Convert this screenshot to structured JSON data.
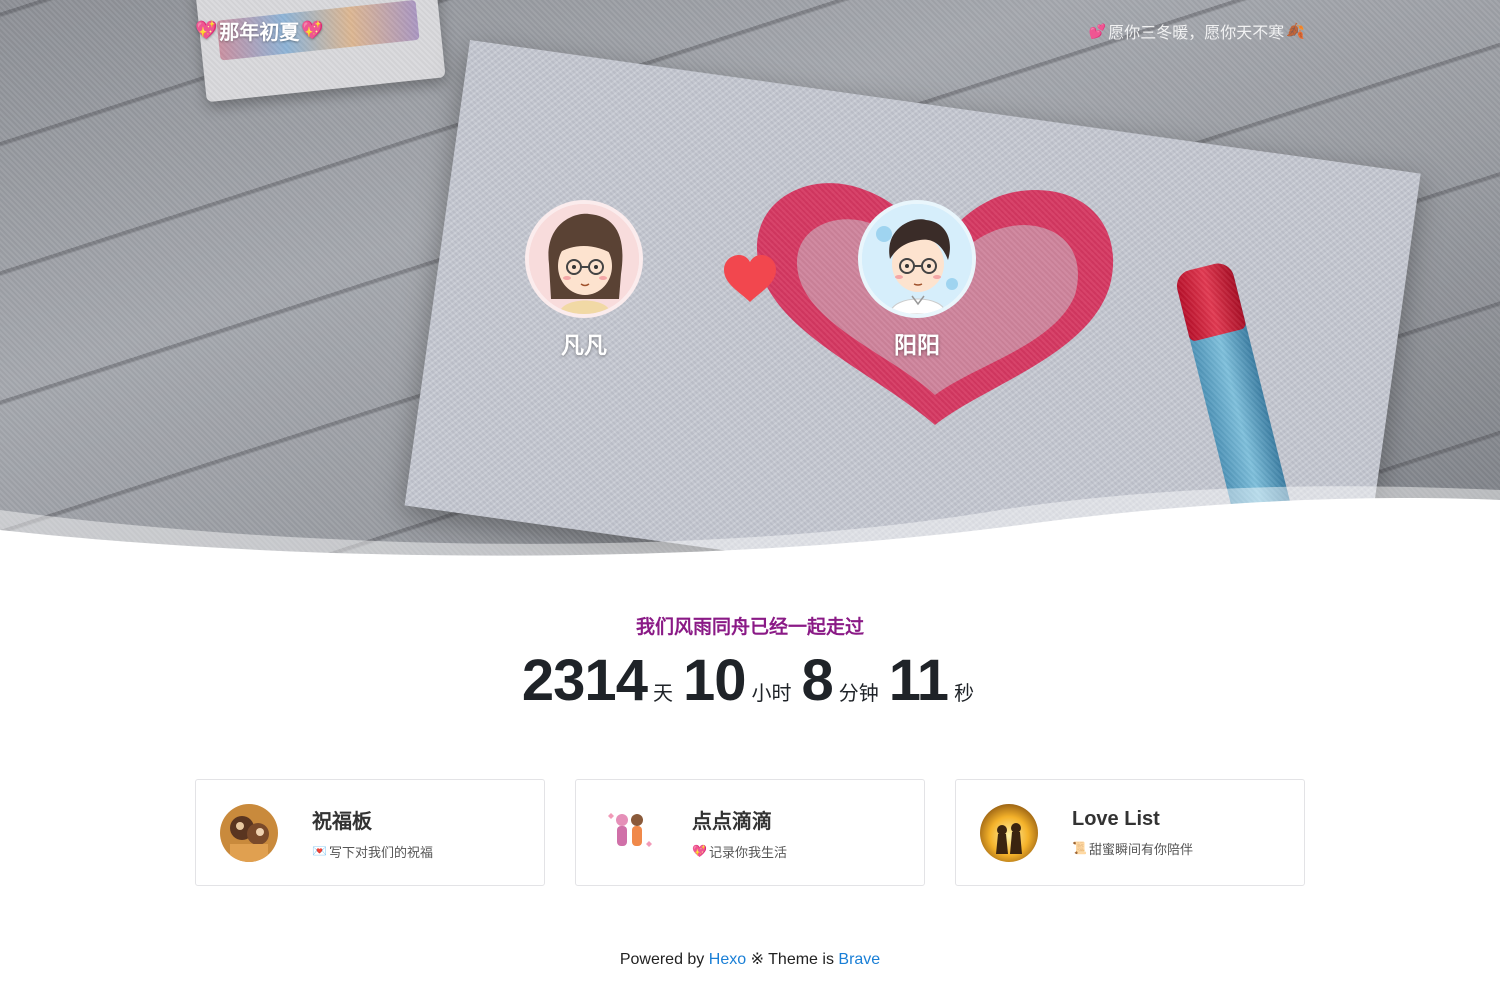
{
  "header": {
    "site_title": "那年初夏",
    "slogan": "愿你三冬暖，愿你天不寒"
  },
  "couple": {
    "left_name": "凡凡",
    "right_name": "阳阳"
  },
  "counter": {
    "title": "我们风雨同舟已经一起走过",
    "days": "2314",
    "days_unit": "天",
    "hours": "10",
    "hours_unit": "小时",
    "minutes": "8",
    "minutes_unit": "分钟",
    "seconds": "11",
    "seconds_unit": "秒"
  },
  "cards": [
    {
      "title": "祝福板",
      "subtitle": "写下对我们的祝福",
      "icon": "envelope-icon"
    },
    {
      "title": "点点滴滴",
      "subtitle": "记录你我生活",
      "icon": "sparkling-heart-icon"
    },
    {
      "title": "Love List",
      "subtitle": "甜蜜瞬间有你陪伴",
      "icon": "scroll-icon"
    }
  ],
  "footer": {
    "powered_by": "Powered by",
    "hexo": "Hexo",
    "separator": "※ Theme is",
    "brave": "Brave"
  },
  "colors": {
    "counter_title": "#8a1a86",
    "link": "#1a7fd6",
    "heart": "#f2474e"
  }
}
